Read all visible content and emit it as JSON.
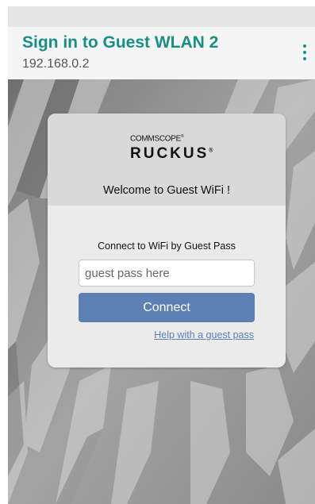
{
  "header": {
    "title": "Sign in to Guest WLAN 2",
    "url": "192.168.0.2"
  },
  "portal": {
    "logo_top": "COMMSCOPE",
    "logo_top_mark": "®",
    "logo_bottom": "RUCKUS",
    "logo_bottom_mark": "®",
    "welcome": "Welcome to Guest WiFi !",
    "pass_label": "Connect to WiFi by Guest Pass",
    "pass_placeholder": "guest pass here",
    "pass_value": "",
    "connect_label": "Connect",
    "help_link": "Help with a guest pass"
  },
  "colors": {
    "title": "#168f86",
    "button": "#5b80b4",
    "link": "#5b80b4"
  },
  "icons": {
    "menu": "more-vert-icon"
  }
}
